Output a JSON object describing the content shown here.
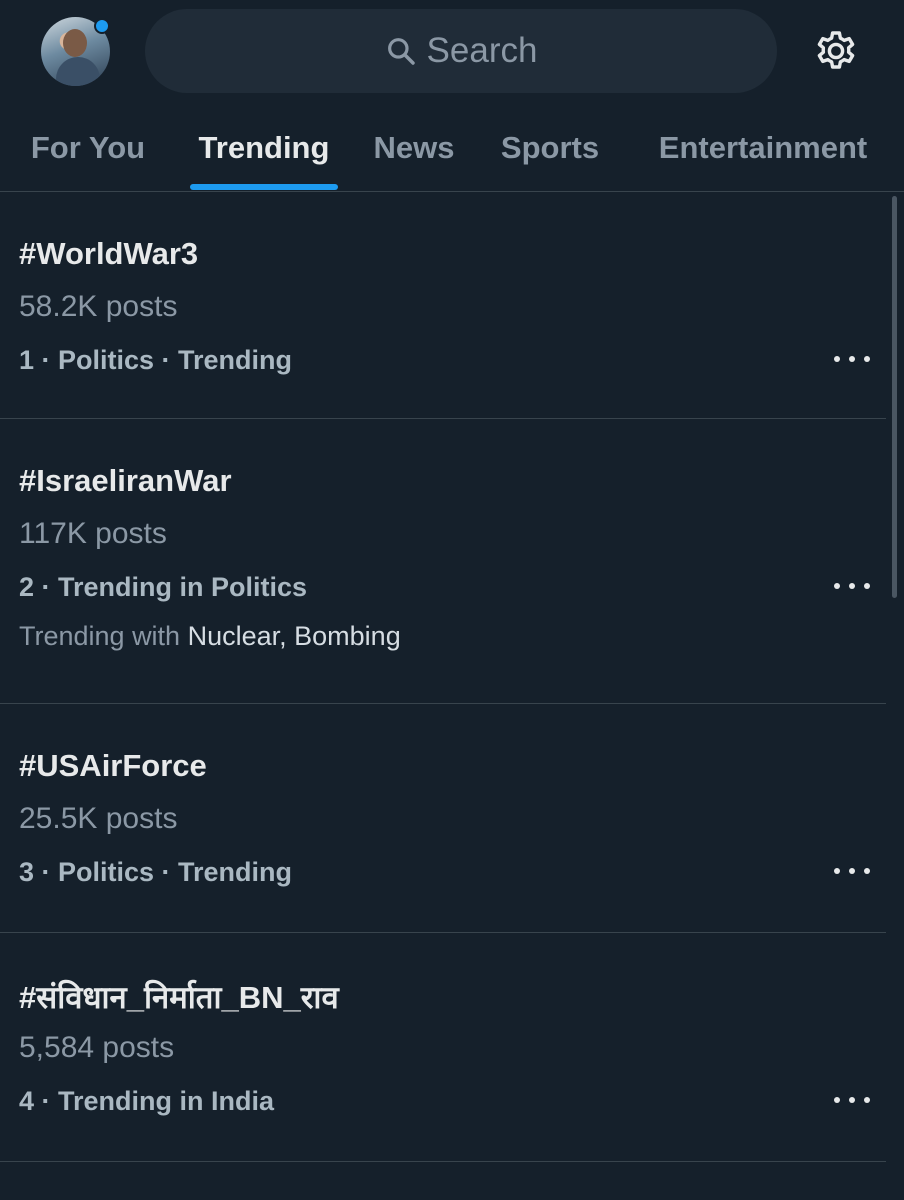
{
  "header": {
    "search_placeholder": "Search"
  },
  "tabs": [
    {
      "label": "For You",
      "active": false
    },
    {
      "label": "Trending",
      "active": true
    },
    {
      "label": "News",
      "active": false
    },
    {
      "label": "Sports",
      "active": false
    },
    {
      "label": "Entertainment",
      "active": false
    }
  ],
  "trends": [
    {
      "title": "#WorldWar3",
      "posts": "58.2K posts",
      "meta": "1 · Politics · Trending"
    },
    {
      "title": "#IsraeliranWar",
      "posts": "117K posts",
      "meta": "2 · Trending in Politics",
      "trending_with_label": "Trending with",
      "trending_with_topics": "Nuclear, Bombing"
    },
    {
      "title": "#USAirForce",
      "posts": "25.5K posts",
      "meta": "3 · Politics · Trending"
    },
    {
      "title": "#संविधान_निर्माता_BN_राव",
      "posts": "5,584 posts",
      "meta": "4 · Trending in India"
    }
  ],
  "colors": {
    "background": "#15202b",
    "accent": "#1d9bf0",
    "divider": "#38444d",
    "secondary_text": "#8b98a5"
  },
  "icons": {
    "search": "search-icon",
    "settings": "gear-icon",
    "more": "more-horizontal-icon"
  }
}
